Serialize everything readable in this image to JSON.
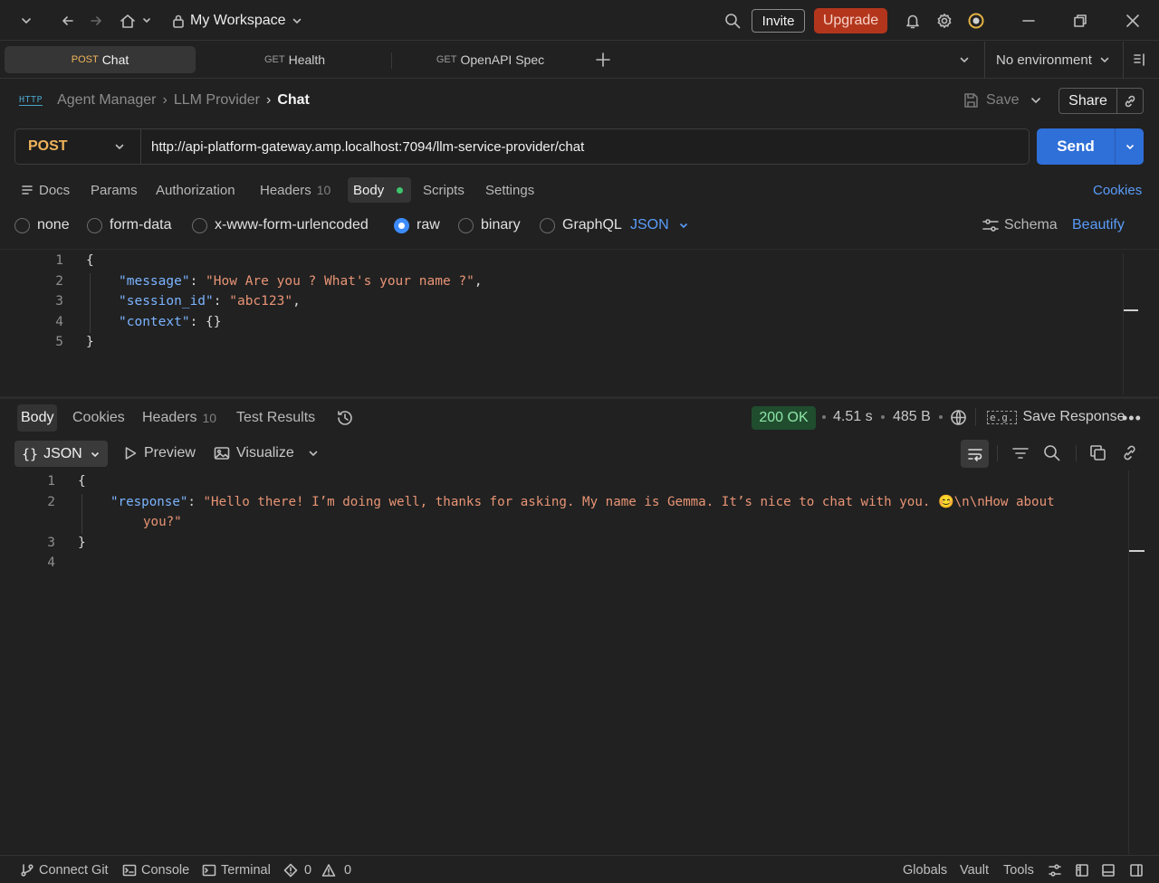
{
  "titlebar": {
    "workspace": "My Workspace",
    "invite": "Invite",
    "upgrade": "Upgrade"
  },
  "tabs": [
    {
      "method": "POST",
      "label": "Chat",
      "method_color": "#f0b45b"
    },
    {
      "method": "GET",
      "label": "Health",
      "method_color": "#7fb98a"
    },
    {
      "method": "GET",
      "label": "OpenAPI Spec",
      "method_color": "#7fb98a"
    }
  ],
  "environment": "No environment",
  "breadcrumb": {
    "icon_label": "HTTP",
    "items": [
      "Agent Manager",
      "LLM Provider"
    ],
    "current": "Chat"
  },
  "actions": {
    "save": "Save",
    "share": "Share"
  },
  "request": {
    "method": "POST",
    "url": "http://api-platform-gateway.amp.localhost:7094/llm-service-provider/chat",
    "send": "Send"
  },
  "request_tabs": {
    "docs": "Docs",
    "params": "Params",
    "authorization": "Authorization",
    "headers": "Headers",
    "headers_count": "10",
    "body": "Body",
    "scripts": "Scripts",
    "settings": "Settings",
    "cookies": "Cookies"
  },
  "body_modes": {
    "none": "none",
    "form_data": "form-data",
    "urlencoded": "x-www-form-urlencoded",
    "raw": "raw",
    "binary": "binary",
    "graphql": "GraphQL",
    "language": "JSON",
    "schema": "Schema",
    "beautify": "Beautify"
  },
  "request_body": {
    "line_numbers": [
      "1",
      "2",
      "3",
      "4",
      "5"
    ],
    "open_brace": "{",
    "close_brace": "}",
    "message_key": "\"message\"",
    "message_value": "\"How Are you ? What's your name ?\"",
    "session_key": "\"session_id\"",
    "session_value": "\"abc123\"",
    "context_key": "\"context\"",
    "context_value": "{}"
  },
  "response_tabs": {
    "body": "Body",
    "cookies": "Cookies",
    "headers": "Headers",
    "headers_count": "10",
    "test_results": "Test Results"
  },
  "response_meta": {
    "status": "200 OK",
    "time": "4.51 s",
    "size": "485 B",
    "save_response": "Save Response"
  },
  "response_view": {
    "format": "JSON",
    "preview": "Preview",
    "visualize": "Visualize"
  },
  "response_body": {
    "line_numbers": [
      "1",
      "2",
      "3",
      "4"
    ],
    "open_brace": "{",
    "close_brace": "}",
    "response_key": "\"response\"",
    "response_value_line1": "\"Hello there! I’m doing well, thanks for asking. My name is Gemma. It’s nice to chat with you. 😊\\n\\nHow about",
    "response_value_line2": "you?\""
  },
  "footer": {
    "connect_git": "Connect Git",
    "console": "Console",
    "terminal": "Terminal",
    "errors": "0",
    "warnings": "0",
    "globals": "Globals",
    "vault": "Vault",
    "tools": "Tools"
  }
}
